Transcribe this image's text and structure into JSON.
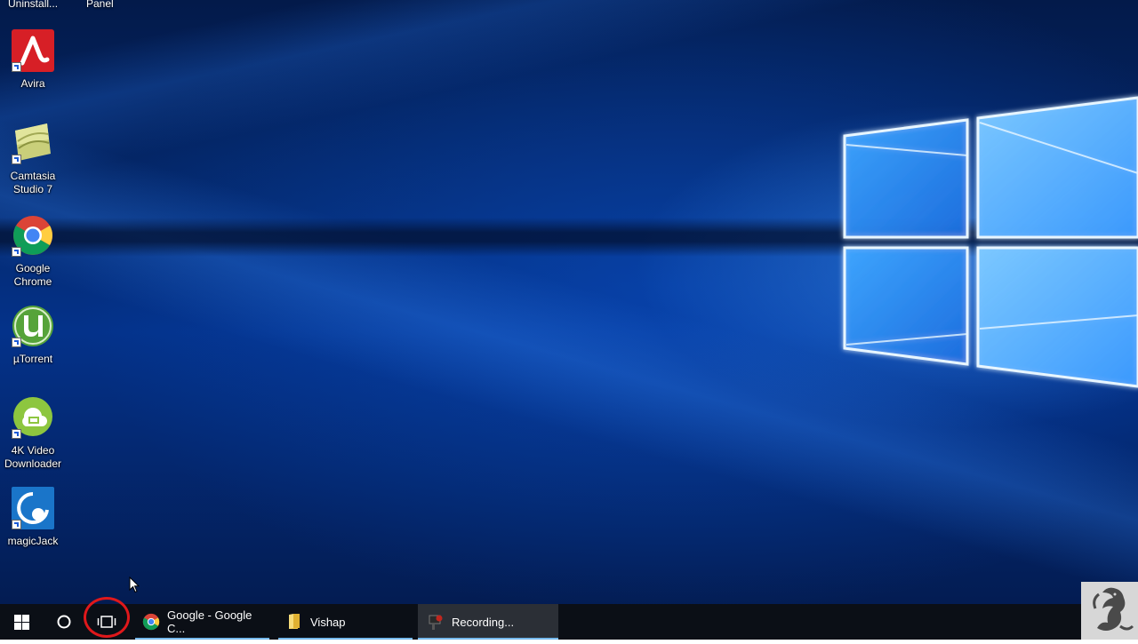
{
  "desktop": {
    "top_labels": [
      "Uninstall...",
      "Panel"
    ],
    "icons": [
      {
        "label": "Avira",
        "icon": "avira-icon"
      },
      {
        "label": "Camtasia Studio 7",
        "icon": "camtasia-icon"
      },
      {
        "label": "Google Chrome",
        "icon": "chrome-icon"
      },
      {
        "label": "µTorrent",
        "icon": "utorrent-icon"
      },
      {
        "label": "4K Video Downloader",
        "icon": "4k-video-downloader-icon"
      },
      {
        "label": "magicJack",
        "icon": "magicjack-icon"
      }
    ]
  },
  "taskbar": {
    "start_icon": "windows-logo-icon",
    "search_icon": "cortana-circle-icon",
    "task_view_icon": "task-view-icon",
    "tasks": [
      {
        "label": "Google - Google C...",
        "icon": "chrome-icon"
      },
      {
        "label": "Vishap",
        "icon": "folder-icon"
      },
      {
        "label": "Recording...",
        "icon": "recorder-icon"
      }
    ]
  },
  "colors": {
    "taskbar_bg": "#0b0f16",
    "highlight_ring": "#e0181b",
    "task_underline": "#76b9ed",
    "wallpaper_blue": "#04328a"
  }
}
